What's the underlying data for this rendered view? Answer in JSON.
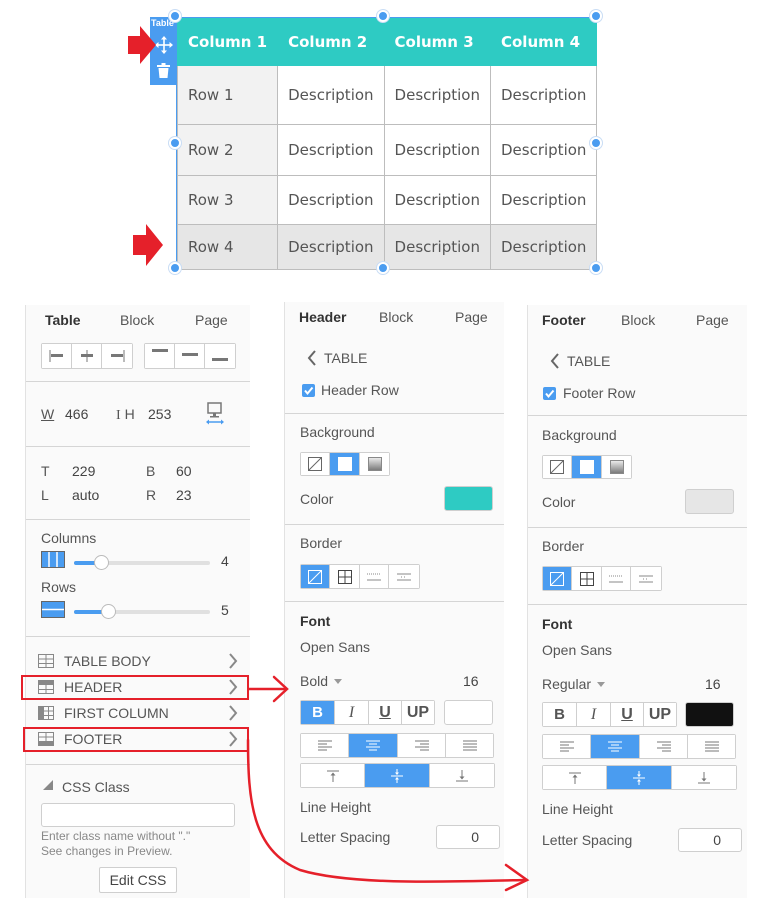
{
  "preview": {
    "toolbox_label": "Table",
    "header": [
      "Column 1",
      "Column 2",
      "Column 3",
      "Column 4"
    ],
    "rows": [
      [
        "Row 1",
        "Description",
        "Description",
        "Description"
      ],
      [
        "Row 2",
        "Description",
        "Description",
        "Description"
      ],
      [
        "Row 3",
        "Description",
        "Description",
        "Description"
      ],
      [
        "Row 4",
        "Description",
        "Description",
        "Description"
      ]
    ],
    "header_color": "#2ecbc3",
    "selection_color": "#4a9cf0"
  },
  "table_panel": {
    "tabs": [
      "Table",
      "Block",
      "Page"
    ],
    "active_tab": "Table",
    "size": {
      "w_label": "W",
      "w_value": "466",
      "h_label": "H",
      "h_value": "253"
    },
    "position": {
      "t_label": "T",
      "t_value": "229",
      "b_label": "B",
      "b_value": "60",
      "l_label": "L",
      "l_value": "auto",
      "r_label": "R",
      "r_value": "23"
    },
    "columns": {
      "label": "Columns",
      "value": "4",
      "fraction": 0.2
    },
    "rows": {
      "label": "Rows",
      "value": "5",
      "fraction": 0.25
    },
    "sections": [
      {
        "label": "TABLE BODY",
        "icon": "table-body-icon"
      },
      {
        "label": "HEADER",
        "icon": "table-header-icon"
      },
      {
        "label": "FIRST COLUMN",
        "icon": "first-column-icon"
      },
      {
        "label": "FOOTER",
        "icon": "table-footer-icon"
      }
    ],
    "css_class": {
      "label": "CSS Class",
      "value": "",
      "hint_line1": "Enter class name without \".\"",
      "hint_line2": "See changes in Preview.",
      "edit_button": "Edit CSS"
    }
  },
  "header_panel": {
    "tabs": [
      "Header",
      "Block",
      "Page"
    ],
    "active_tab": "Header",
    "back_label": "TABLE",
    "checkbox_label": "Header Row",
    "checked": true,
    "background_label": "Background",
    "background_mode": "solid",
    "color_label": "Color",
    "color_value": "#2ecbc3",
    "border_label": "Border",
    "font_label": "Font",
    "font_family": "Open Sans",
    "font_weight": "Bold",
    "font_size": "16",
    "style_buttons": [
      "B",
      "I",
      "U",
      "UP"
    ],
    "bold_active": true,
    "text_color": "#ffffff",
    "align_active": "center",
    "valign_active": "middle",
    "line_height_label": "Line Height",
    "letter_spacing_label": "Letter Spacing",
    "letter_spacing_value": "0"
  },
  "footer_panel": {
    "tabs": [
      "Footer",
      "Block",
      "Page"
    ],
    "active_tab": "Footer",
    "back_label": "TABLE",
    "checkbox_label": "Footer Row",
    "checked": true,
    "background_label": "Background",
    "background_mode": "solid",
    "color_label": "Color",
    "color_value": "#e6e6e6",
    "border_label": "Border",
    "font_label": "Font",
    "font_family": "Open Sans",
    "font_weight": "Regular",
    "font_size": "16",
    "style_buttons": [
      "B",
      "I",
      "U",
      "UP"
    ],
    "bold_active": false,
    "text_color": "#111111",
    "align_active": "center",
    "valign_active": "middle",
    "line_height_label": "Line Height",
    "letter_spacing_label": "Letter Spacing",
    "letter_spacing_value": "0"
  },
  "annotation_color": "#e5202a"
}
